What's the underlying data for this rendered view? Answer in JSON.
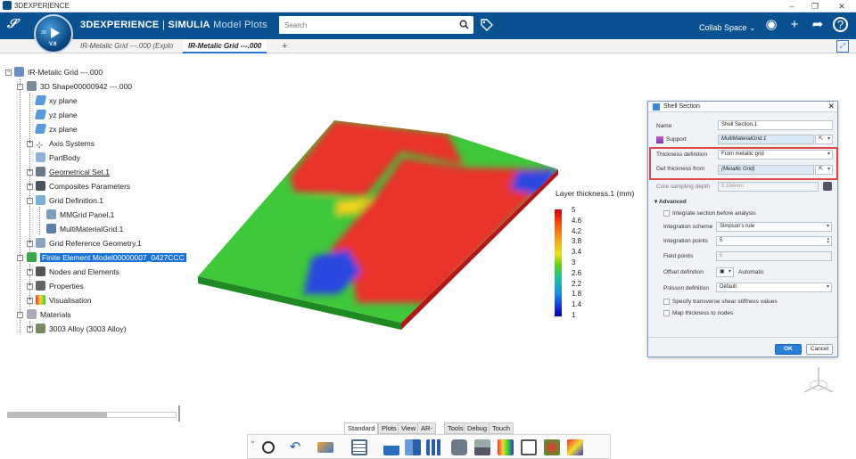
{
  "window": {
    "title": "3DEXPERIENCE",
    "min": "–",
    "max": "❐",
    "close": "✕"
  },
  "brand": {
    "main": "3DEXPERIENCE",
    "sep": "|",
    "product": "SIMULIA",
    "app": "Model Plots"
  },
  "compass": {
    "label3d": "3D",
    "version": "V.6"
  },
  "search": {
    "placeholder": "Search"
  },
  "collab": {
    "label": "Collab Space ⌄"
  },
  "tabs": [
    {
      "label": "IR-Metalic Grid ---.000 (Explo"
    },
    {
      "label": "IR-Metalic Grid ---.000"
    },
    {
      "label": "+"
    }
  ],
  "tree": {
    "root": "IR-Metalic Grid ---.000",
    "shape": "3D Shape00000942 ---.000",
    "xy": "xy plane",
    "yz": "yz plane",
    "zx": "zx plane",
    "axis": "Axis Systems",
    "partbody": "PartBody",
    "geoset": "Geometrical Set.1",
    "composites": "Composites Parameters",
    "griddef": "Grid Definition.1",
    "mmgrid": "MMGrid Panel.1",
    "multimat": "MultiMaterialGrid.1",
    "gridref": "Grid Reference Geometry.1",
    "fem": "Finite Element Model00000007_0427CCC",
    "nodes": "Nodes and Elements",
    "props": "Properties",
    "vis": "Visualisation",
    "materials": "Materials",
    "alloy": "3003 Alloy (3003 Alloy)"
  },
  "legend": {
    "title": "Layer thickness.1 (mm)",
    "ticks": [
      "5",
      "4.6",
      "4.2",
      "3.8",
      "3.4",
      "3",
      "2.6",
      "2.2",
      "1.8",
      "1.4",
      "1"
    ]
  },
  "dialog": {
    "title": "Shell Section",
    "close": "✕",
    "name_label": "Name",
    "name_value": "Shell Section.1",
    "support_label": "Support",
    "support_value": "MultiMaterialGrid.1",
    "thick_def_label": "Thickness definition",
    "thick_def_value": "From metallic grid",
    "get_thick_label": "Get thickness from",
    "get_thick_value": "(Metallic Grid)",
    "core_label": "Core sampling depth",
    "core_value": "5.194mm",
    "advanced": "▾ Advanced",
    "integrate": "Integrate section before analysis",
    "scheme_label": "Integration scheme",
    "scheme_value": "Simpson's rule",
    "points_label": "Integration points",
    "points_value": "5",
    "field_label": "Field points",
    "field_value": "5",
    "offset_label": "Offset definition",
    "offset_value": "Automatic",
    "poisson_label": "Poisson definition",
    "poisson_value": "Default",
    "shear": "Specify transverse shear stiffness values",
    "map": "Map thickness to nodes",
    "ok": "OK",
    "cancel": "Cancel"
  },
  "toolbar_tabs": [
    "Standard",
    "Plots",
    "View",
    "AR-VR",
    "Tools",
    "Debug",
    "Touch"
  ],
  "colors": {
    "topbar": "#0a5191",
    "accent": "#2a77c9",
    "highlight": "#e04848",
    "selection": "#1a73d9"
  }
}
